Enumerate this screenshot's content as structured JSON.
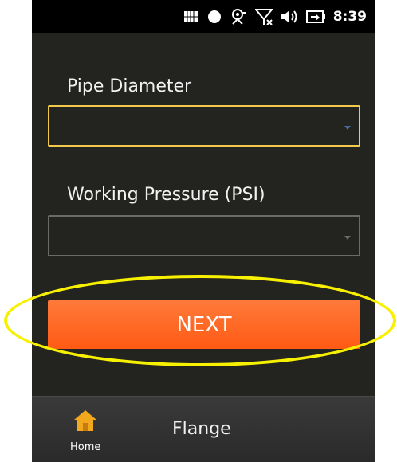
{
  "status_bar": {
    "time": "8:39"
  },
  "form": {
    "pipe_diameter_label": "Pipe Diameter",
    "pipe_diameter_value": "",
    "working_pressure_label": "Working Pressure (PSI)",
    "working_pressure_value": ""
  },
  "next_button": {
    "label": "NEXT"
  },
  "bottom_bar": {
    "home_label": "Home",
    "title": "Flange"
  },
  "colors": {
    "background": "#23241f",
    "accent_button": "#ff6a24",
    "focus_border": "#f2c94c",
    "highlight_ring": "#f7f000"
  },
  "icons": [
    "grid-status-icon",
    "record-dot-icon",
    "gps-icon",
    "no-signal-icon",
    "volume-icon",
    "battery-icon",
    "home-icon"
  ]
}
